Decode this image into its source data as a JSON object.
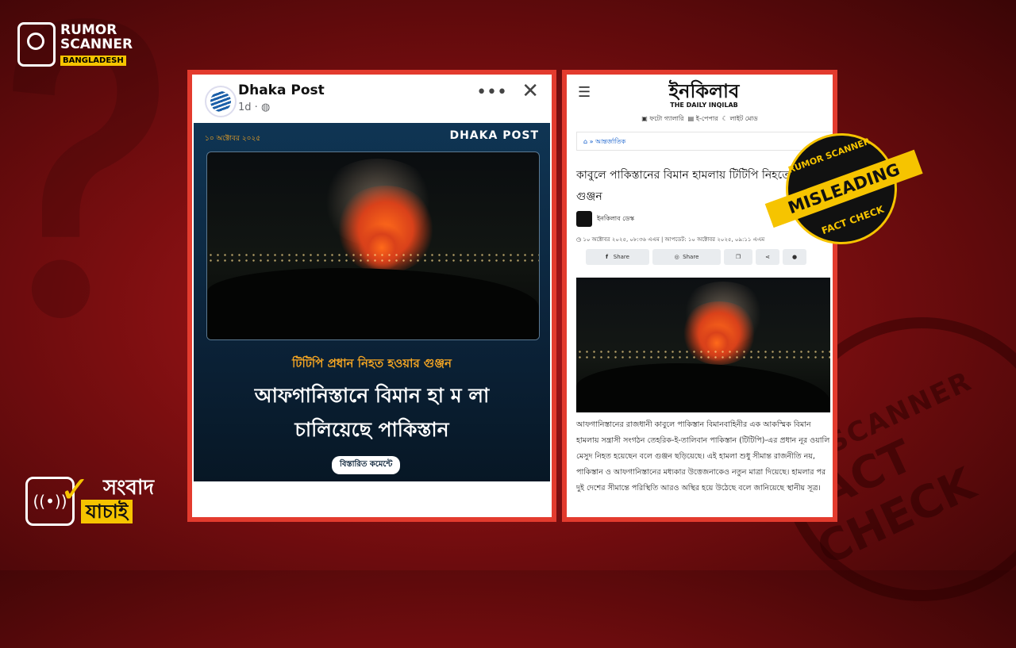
{
  "branding": {
    "rumor_scanner_line1": "RUMOR",
    "rumor_scanner_line2": "SCANNER",
    "rumor_scanner_sub": "BANGLADESH",
    "sangbad_line1": "সংবাদ",
    "sangbad_line2": "যাচাই"
  },
  "facebook_post": {
    "page_name": "Dhaka Post",
    "time": "1d ·",
    "image": {
      "date": "১০ অক্টোবর ২০২৫",
      "logo": "DHAKA POST",
      "kicker": "টিটিপি প্রধান নিহত হওয়ার গুঞ্জন",
      "title_line1": "আফগানিস্তানে বিমান হা ম লা",
      "title_line2": "চালিয়েছে পাকিস্তান",
      "button": "বিস্তারিত কমেন্টে"
    }
  },
  "inqilab_article": {
    "logo_bn": "ইনকিলাব",
    "logo_en": "THE DAILY INQILAB",
    "links": [
      "ফটো গ্যালারি",
      "ই-পেপার",
      "লাইট মোড"
    ],
    "category": "আন্তর্জাতিক",
    "title": "কাবুলে পাকিস্তানের বিমান হামলায় টিটিপি নিহতের গুঞ্জন",
    "author": "ইনকিলাব ডেস্ক",
    "meta": "১০ অক্টোবর ২০২৫, ০৮:৩৬ এএম | আপডেট: ১০ অক্টোবর ২০২৫, ০৯:১১ এএম",
    "share_labels": [
      "Share",
      "Share"
    ],
    "body": "আফগানিস্তানের রাজধানী কাবুলে পাকিস্তান বিমানবাহিনীর এক আকস্মিক বিমান হামলায় সন্ত্রাসী সংগঠন তেহরিক-ই-তালিবান পাকিস্তান (টিটিপি)-এর প্রধান নূর ওয়ালি মেসুদ নিহত হয়েছেন বলে গুঞ্জন ছড়িয়েছে। এই হামলা শুধু সীমান্ত রাজনীতি নয়, পাকিস্তান ও আফগানিস্তানের মধ্যকার উত্তেজনাকেও নতুন মাত্রা দিয়েছে। হামলার পর দুই দেশের সীমান্তে পরিস্থিতি আরও অস্থির হয়ে উঠেছে বলে জানিয়েছে স্থানীয় সূত্র।"
  },
  "stamp": {
    "top": "RUMOR SCANNER",
    "band": "MISLEADING",
    "bottom": "FACT CHECK",
    "bg_top": "SCANNER",
    "bg_bottom": "FACT CHECK"
  },
  "colors": {
    "frame": "#e33b2e",
    "accent_yellow": "#f6c400",
    "background_red": "#a3151a"
  }
}
